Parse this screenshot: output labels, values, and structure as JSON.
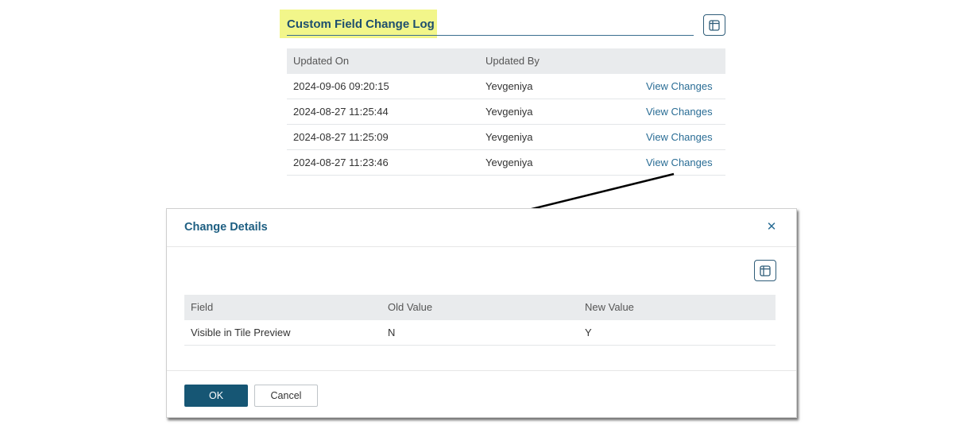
{
  "change_log": {
    "title": "Custom Field Change Log",
    "highlight_color": "#f2f68a",
    "columns": [
      "Updated On",
      "Updated By",
      ""
    ],
    "rows": [
      {
        "updated_on": "2024-09-06 09:20:15",
        "updated_by": "Yevgeniya",
        "action": "View Changes"
      },
      {
        "updated_on": "2024-08-27 11:25:44",
        "updated_by": "Yevgeniya",
        "action": "View Changes"
      },
      {
        "updated_on": "2024-08-27 11:25:09",
        "updated_by": "Yevgeniya",
        "action": "View Changes"
      },
      {
        "updated_on": "2024-08-27 11:23:46",
        "updated_by": "Yevgeniya",
        "action": "View Changes"
      }
    ],
    "column_toggle_icon": "table-columns-icon"
  },
  "dialog": {
    "title": "Change Details",
    "close_icon": "close-icon",
    "column_toggle_icon": "table-columns-icon",
    "columns": [
      "Field",
      "Old Value",
      "New Value"
    ],
    "rows": [
      {
        "field": "Visible in Tile Preview",
        "old_value": "N",
        "new_value": "Y"
      }
    ],
    "ok_label": "OK",
    "cancel_label": "Cancel"
  },
  "colors": {
    "accent": "#165674",
    "link": "#2a6d95",
    "header_bg": "#e9ebed"
  }
}
